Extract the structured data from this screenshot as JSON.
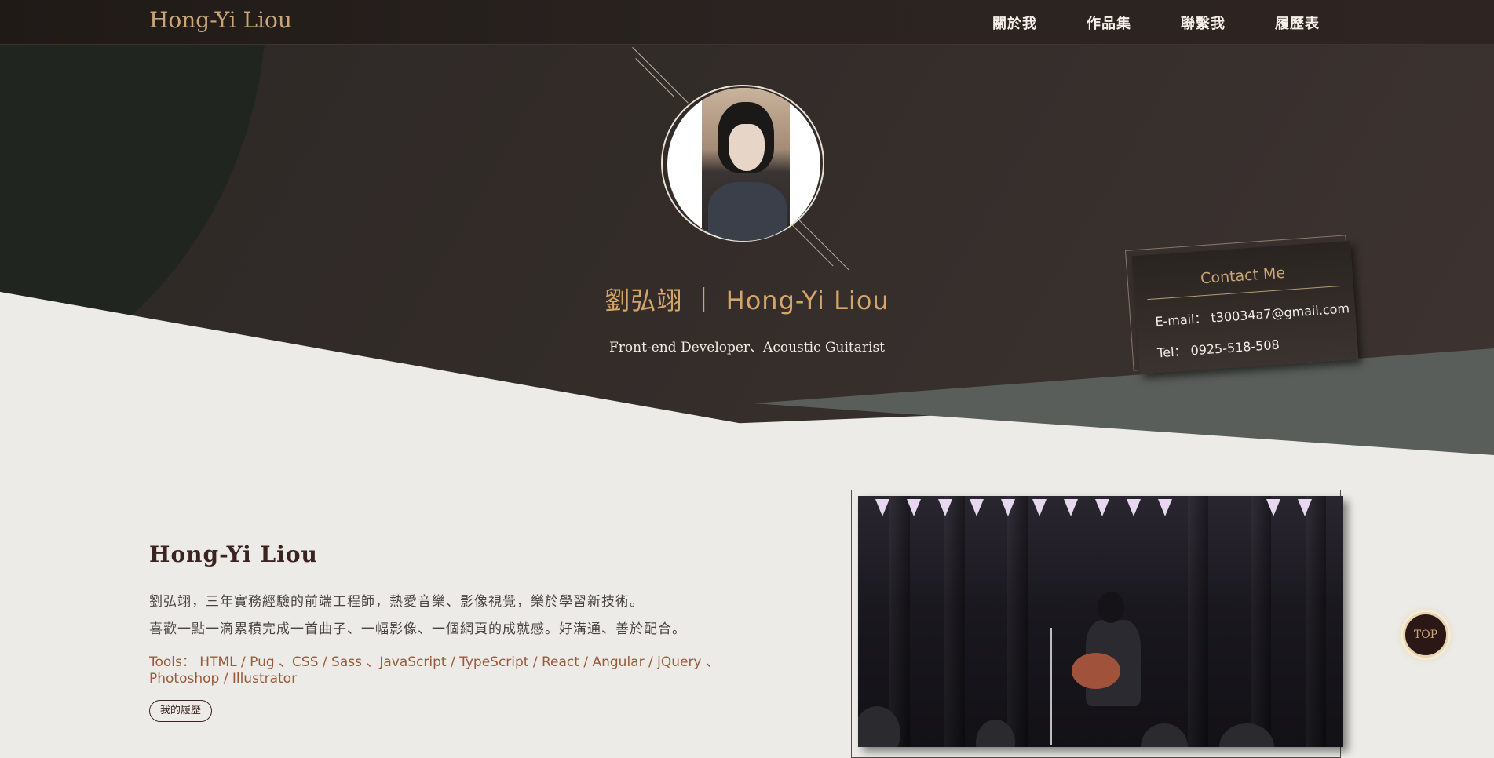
{
  "nav": {
    "brand": "Hong-Yi Liou",
    "links": [
      "關於我",
      "作品集",
      "聯繫我",
      "履歷表"
    ]
  },
  "hero": {
    "name": "劉弘翊 ｜ Hong-Yi Liou",
    "subtitle": "Front-end Developer、Acoustic Guitarist"
  },
  "contact": {
    "title": "Contact Me",
    "email": "E-mail： t30034a7@gmail.com",
    "tel": "Tel： 0925-518-508"
  },
  "about": {
    "title": "Hong-Yi Liou",
    "para1": "劉弘翊，三年實務經驗的前端工程師，熱愛音樂、影像視覺，樂於學習新技術。",
    "para2": "喜歡一點一滴累積完成一首曲子、一幅影像、一個網頁的成就感。好溝通、善於配合。",
    "tools": "Tools： HTML / Pug 、CSS / Sass 、JavaScript / TypeScript / React / Angular / jQuery 、Photoshop / Illustrator",
    "resume_button": "我的履歷"
  },
  "top_button": "TOP",
  "colors": {
    "accent_gold": "#c9a577",
    "hero_bg": "#2d2826",
    "page_bg": "#ecebe7",
    "tools_text": "#9a5a3a"
  }
}
